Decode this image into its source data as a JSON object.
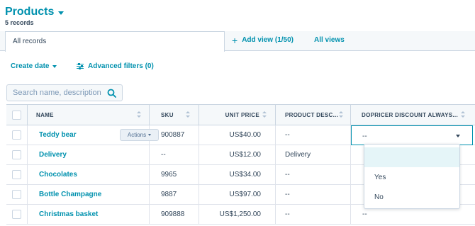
{
  "header": {
    "title": "Products",
    "record_count": "5 records"
  },
  "tabs": {
    "active": "All records",
    "add_view": "Add view (1/50)",
    "all_views": "All views"
  },
  "filters": {
    "create_date": "Create date",
    "advanced": "Advanced filters (0)"
  },
  "search": {
    "placeholder": "Search name, description"
  },
  "table": {
    "columns": [
      "NAME",
      "SKU",
      "UNIT PRICE",
      "PRODUCT DESC...",
      "DOPRICER DISCOUNT ALWAYS..."
    ],
    "actions_label": "Actions",
    "rows": [
      {
        "name": "Teddy bear",
        "sku": "900887",
        "price": "US$40.00",
        "desc": "--",
        "discount": "--"
      },
      {
        "name": "Delivery",
        "sku": "--",
        "price": "US$12.00",
        "desc": "Delivery",
        "discount": ""
      },
      {
        "name": "Chocolates",
        "sku": "9965",
        "price": "US$34.00",
        "desc": "--",
        "discount": ""
      },
      {
        "name": "Bottle Champagne",
        "sku": "9887",
        "price": "US$97.00",
        "desc": "--",
        "discount": ""
      },
      {
        "name": "Christmas basket",
        "sku": "909888",
        "price": "US$1,250.00",
        "desc": "--",
        "discount": "--"
      }
    ]
  },
  "dropdown": {
    "options": [
      "",
      "Yes",
      "No"
    ]
  },
  "colors": {
    "accent": "#0091ae",
    "text": "#33475b",
    "header_bg": "#f5f8fa",
    "border": "#cbd6e2"
  }
}
